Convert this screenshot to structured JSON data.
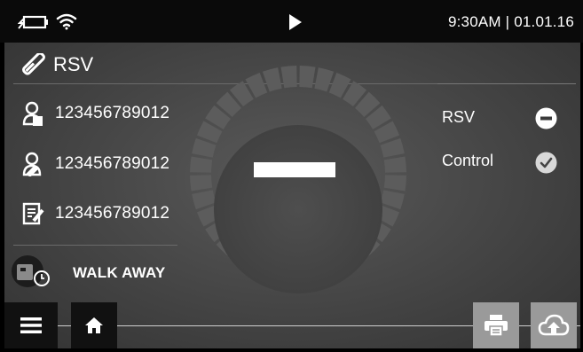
{
  "status_bar": {
    "time_date": "9:30AM | 01.01.16",
    "icons": [
      "battery-charging-icon",
      "wifi-icon",
      "play-icon"
    ]
  },
  "test": {
    "name": "RSV",
    "icon": "dipstick-icon"
  },
  "ids": [
    {
      "icon": "patient-icon",
      "value": "123456789012"
    },
    {
      "icon": "operator-icon",
      "value": "123456789012"
    },
    {
      "icon": "lot-icon",
      "value": "123456789012"
    }
  ],
  "mode": {
    "label": "WALK AWAY",
    "icon": "reader-timer-icon"
  },
  "results": [
    {
      "label": "RSV",
      "status": "negative",
      "icon": "minus-circle-icon"
    },
    {
      "label": "Control",
      "status": "valid",
      "icon": "check-circle-icon"
    }
  ],
  "progress": {
    "value": 0
  },
  "toolbar": [
    "menu-icon",
    "home-icon",
    "print-icon",
    "cloud-upload-icon"
  ]
}
